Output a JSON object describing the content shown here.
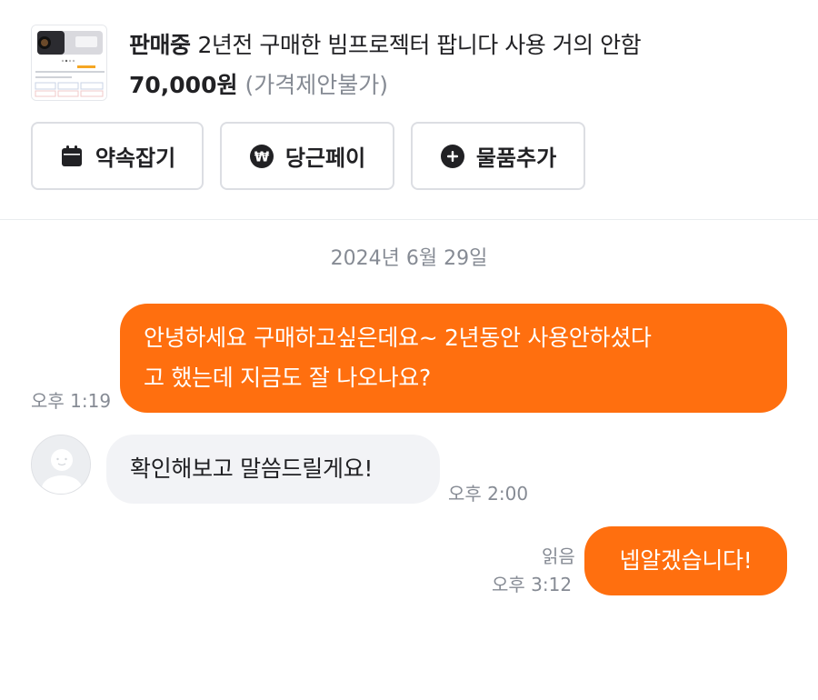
{
  "listing": {
    "status": "판매중",
    "title": "2년전 구매한 빔프로젝터 팝니다 사용 거의 안함",
    "price": "70,000원",
    "price_note": "(가격제안불가)"
  },
  "actions": [
    {
      "label": "약속잡기",
      "icon": "calendar-icon"
    },
    {
      "label": "당근페이",
      "icon": "won-icon"
    },
    {
      "label": "물품추가",
      "icon": "plus-circle-icon"
    }
  ],
  "chat": {
    "date": "2024년 6월 29일",
    "messages": [
      {
        "side": "out",
        "text_line1": "안녕하세요 구매하고싶은데요~ 2년동안 사용안하셨다",
        "text_line2": "고 했는데 지금도 잘 나오나요?",
        "time": "오후 1:19"
      },
      {
        "side": "in",
        "text": "확인해보고 말씀드릴게요!",
        "time": "오후 2:00"
      },
      {
        "side": "out",
        "text": "넵알겠습니다!",
        "read": "읽음",
        "time": "오후 3:12"
      }
    ]
  },
  "colors": {
    "accent": "#ff6f0f",
    "incoming_bubble": "#f2f3f6",
    "muted_text": "#868b94"
  }
}
